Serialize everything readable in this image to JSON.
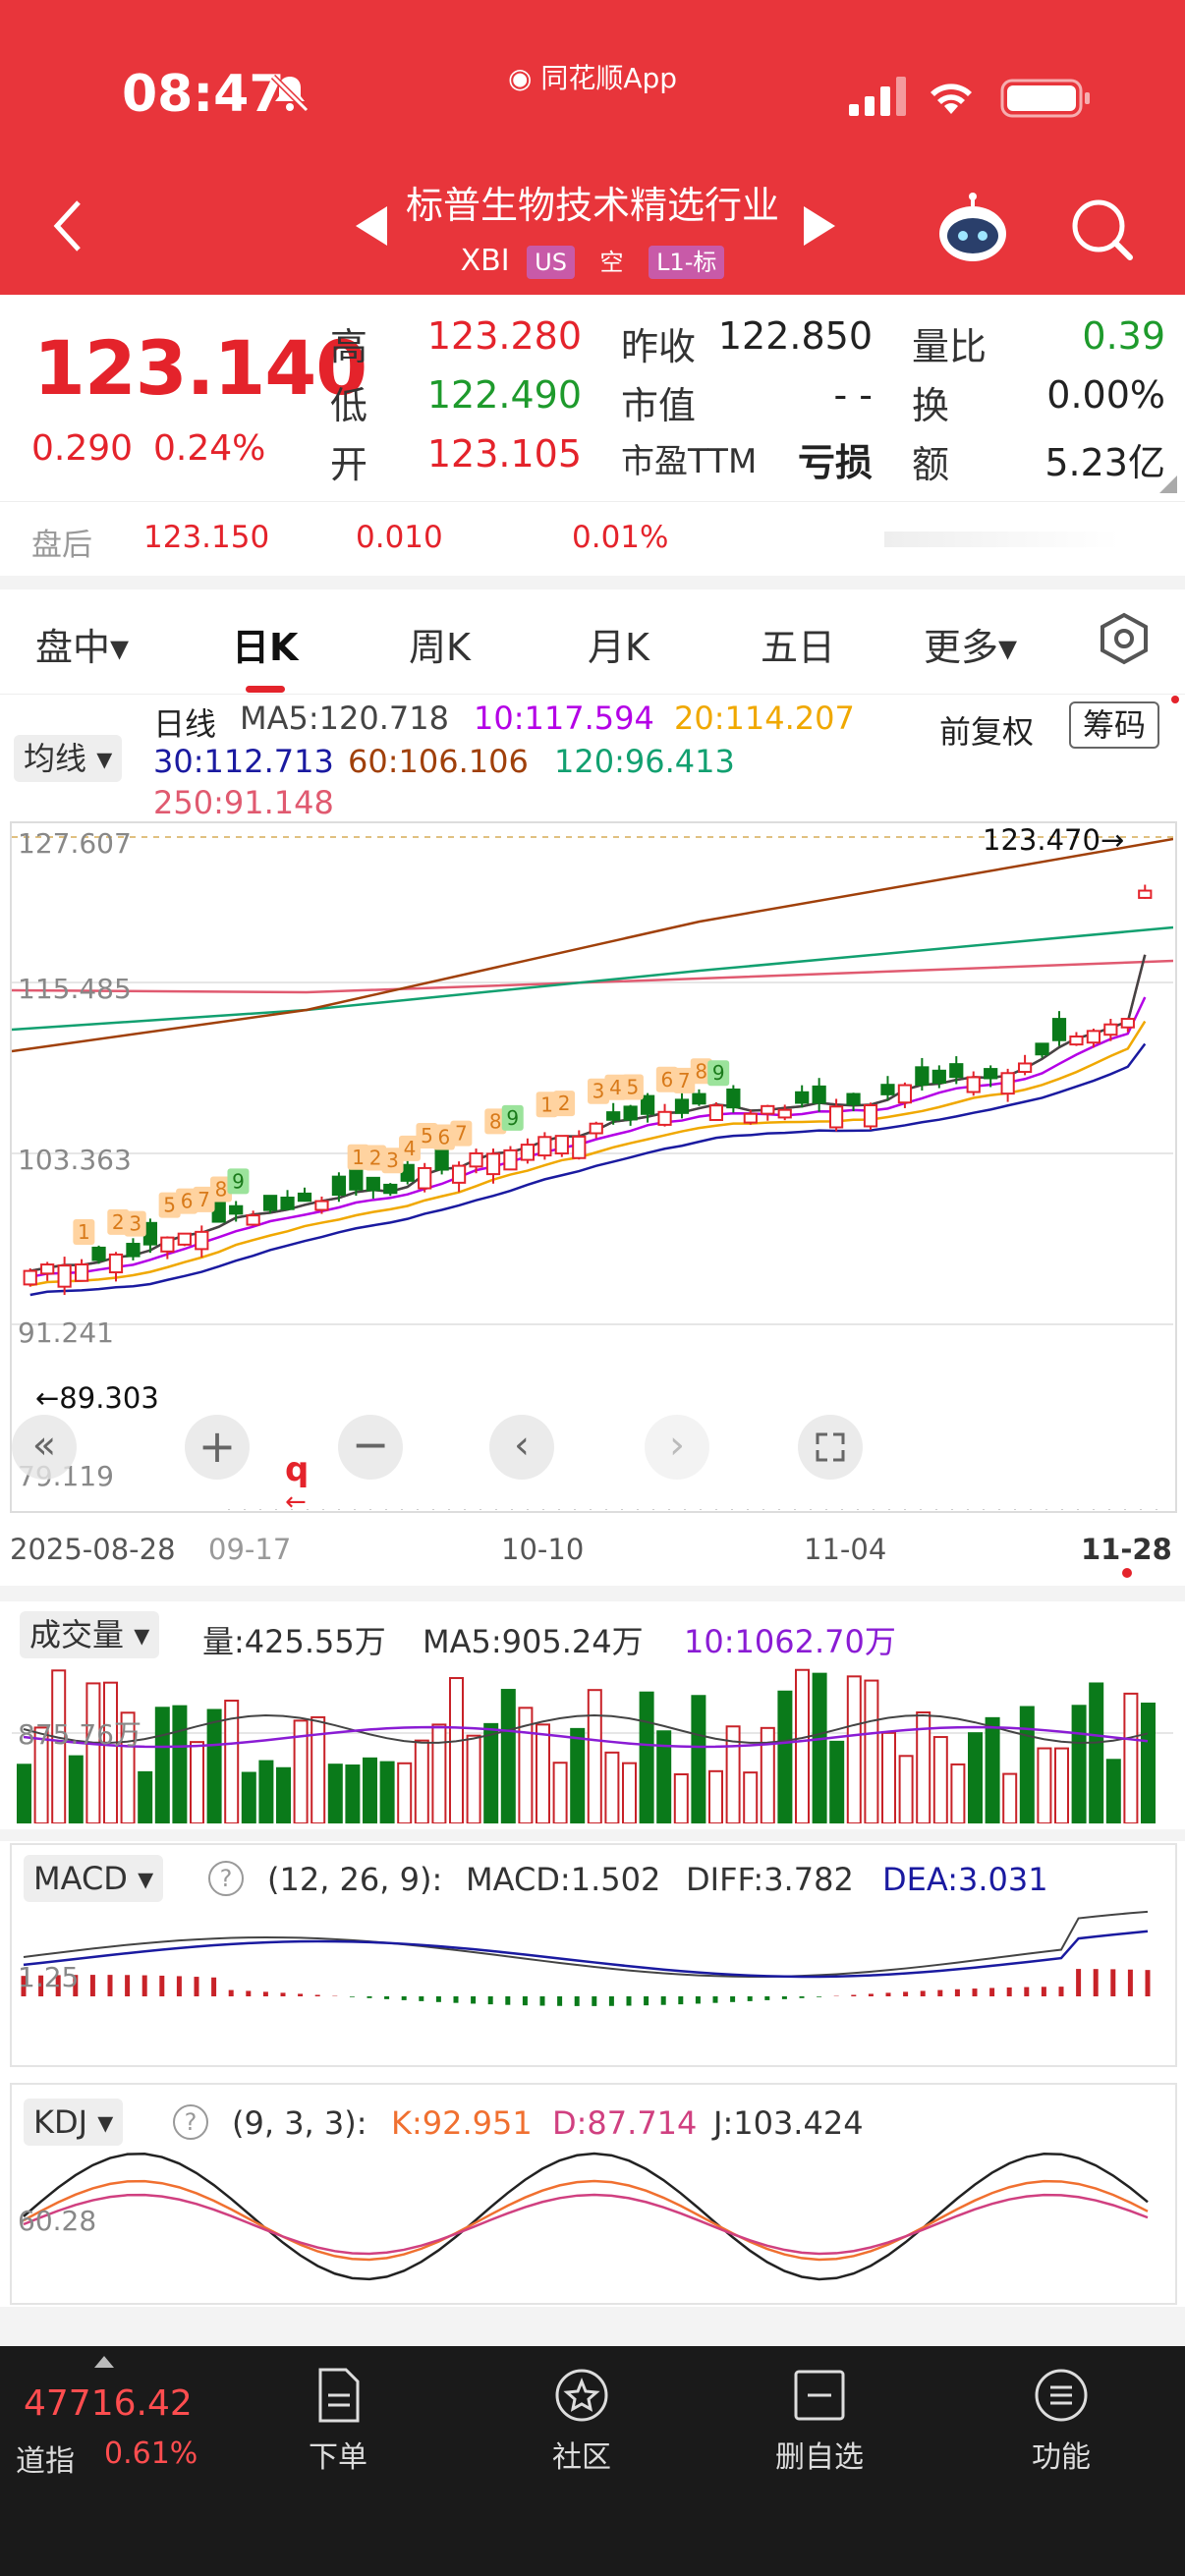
{
  "status": {
    "time": "08:47",
    "app": "同花顺App"
  },
  "header": {
    "title": "标普生物技术精选行业",
    "symbol": "XBI",
    "tag_us": "US",
    "tag_short": "空",
    "tag_l1": "L1-标"
  },
  "quote": {
    "price": "123.140",
    "change": "0.290",
    "change_pct": "0.24%",
    "high_label": "高",
    "high": "123.280",
    "low_label": "低",
    "low": "122.490",
    "open_label": "开",
    "open": "123.105",
    "prev_close_label": "昨收",
    "prev_close": "122.850",
    "mktcap_label": "市值",
    "mktcap": "- -",
    "pe_label": "市盈TTM",
    "pe": "亏损",
    "vol_ratio_label": "量比",
    "vol_ratio": "0.39",
    "turnover_label": "换",
    "turnover": "0.00%",
    "amount_label": "额",
    "amount": "5.23亿"
  },
  "after_hours": {
    "label": "盘后",
    "price": "123.150",
    "change": "0.010",
    "pct": "0.01%"
  },
  "tabs": [
    "盘中▾",
    "日K",
    "周K",
    "月K",
    "五日",
    "更多▾"
  ],
  "ma_panel": {
    "selector": "均线",
    "type": "日线",
    "ma5": "MA5:120.718",
    "ma10": "10:117.594",
    "ma20": "20:114.207",
    "ma30": "30:112.713",
    "ma60": "60:106.106",
    "ma120": "120:96.413",
    "ma250": "250:91.148",
    "adjust": "前复权",
    "chips": "筹码",
    "colors": {
      "ma5": "#444444",
      "ma10": "#b400e6",
      "ma20": "#f0a800",
      "ma30": "#1a1aa0",
      "ma60": "#a0400a",
      "ma120": "#12a070",
      "ma250": "#e05a70"
    }
  },
  "kline": {
    "y_labels": [
      "127.607",
      "115.485",
      "103.363",
      "91.241",
      "79.119"
    ],
    "max_marker": "123.470→",
    "min_marker": "←89.303",
    "x_labels": [
      "2025-08-28",
      "09-17",
      "10-10",
      "11-04",
      "11-28"
    ],
    "float_mark": "q"
  },
  "volume": {
    "selector": "成交量",
    "vol": "量:425.55万",
    "ma5": "MA5:905.24万",
    "ma10": "10:1062.70万",
    "axis": "875.76万"
  },
  "macd": {
    "selector": "MACD",
    "params": "(12, 26, 9):",
    "macd": "MACD:1.502",
    "diff": "DIFF:3.782",
    "dea": "DEA:3.031",
    "axis": "1.25"
  },
  "kdj": {
    "selector": "KDJ",
    "params": "(9, 3, 3):",
    "k": "K:92.951",
    "d": "D:87.714",
    "j": "J:103.424",
    "axis": "60.28"
  },
  "bottom": {
    "index_value": "47716.42",
    "index_name": "道指",
    "index_pct": "0.61%",
    "items": [
      "下单",
      "社区",
      "删自选",
      "功能"
    ]
  }
}
